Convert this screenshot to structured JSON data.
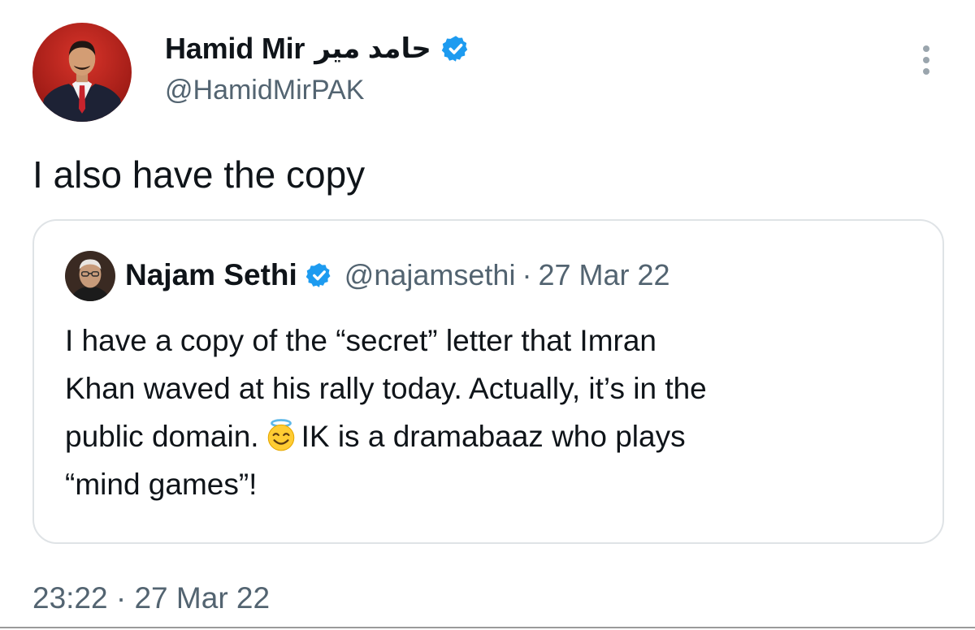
{
  "author": {
    "name": "Hamid Mir",
    "name_urdu": "حامد میر",
    "handle": "@HamidMirPAK"
  },
  "tweet": {
    "text": "I also have the copy",
    "timestamp_time": "23:22",
    "timestamp_sep": "·",
    "timestamp_date": "27 Mar 22"
  },
  "quoted_tweet": {
    "name": "Najam Sethi",
    "handle": "@najamsethi",
    "sep": "·",
    "date": "27 Mar 22",
    "lines": [
      "I have a copy of the “secret” letter that Imran",
      "Khan waved at his rally today. Actually, it’s in the",
      "public domain.",
      "IK is a dramabaaz who plays",
      "“mind games”!"
    ]
  },
  "icons": {
    "verified": "verified-badge-icon",
    "more": "more-options-icon",
    "emoji": "smiling-face-with-halo-emoji"
  },
  "colors": {
    "text": "#0f1419",
    "secondary": "#536471",
    "verified": "#1d9bf0",
    "border": "#dfe3e6"
  }
}
